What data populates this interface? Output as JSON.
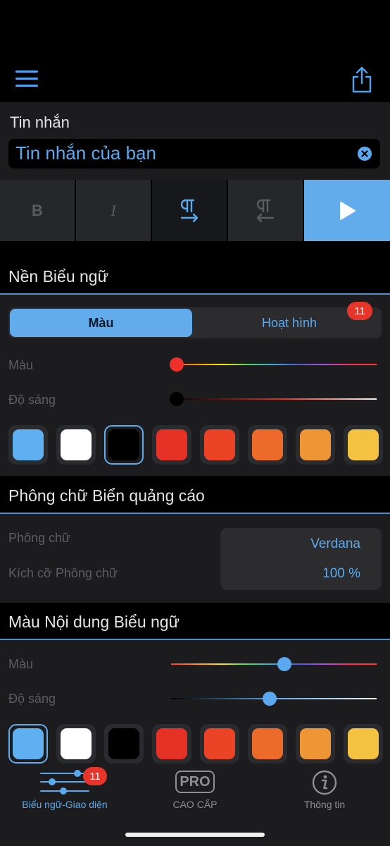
{
  "toolbar": {
    "menu_icon": "hamburger-menu-icon",
    "share_icon": "share-icon"
  },
  "message": {
    "label": "Tin nhắn",
    "value": "Tin nhắn của bạn"
  },
  "format_buttons": [
    {
      "label": "B",
      "name": "bold"
    },
    {
      "label": "I",
      "name": "italic"
    },
    {
      "name": "paragraph-ltr"
    },
    {
      "name": "paragraph-rtl"
    },
    {
      "name": "play"
    }
  ],
  "banner_background": {
    "title": "Nền Biểu ngữ",
    "tab_color": "Màu",
    "tab_animation": "Hoạt hình",
    "animation_badge": "11",
    "hue_label": "Màu",
    "brightness_label": "Độ sáng",
    "hue_value": 0.0,
    "brightness_value": 0.0,
    "swatches": [
      "#5eb0f0",
      "#ffffff",
      "#000000",
      "#e63226",
      "#ea4326",
      "#ec6a2a",
      "#ee9535",
      "#f3c240"
    ],
    "selected_swatch": 2
  },
  "banner_font": {
    "title": "Phông chữ Biển quảng cáo",
    "font_label": "Phông chữ",
    "font_value": "Verdana",
    "size_label": "Kích cỡ Phông chữ",
    "size_value": "100 %"
  },
  "banner_content_color": {
    "title": "Màu Nội dung Biểu ngữ",
    "hue_label": "Màu",
    "brightness_label": "Độ sáng",
    "hue_value": 0.55,
    "brightness_value": 0.48,
    "swatches": [
      "#5eb0f0",
      "#ffffff",
      "#000000",
      "#e63226",
      "#ea4326",
      "#ec6a2a",
      "#ee9535",
      "#f3c240"
    ],
    "selected_swatch": 0
  },
  "tabbar": {
    "tabs": [
      {
        "label": "Biểu ngữ-Giao diện",
        "badge": "11",
        "active": true
      },
      {
        "label": "CAO CẤP",
        "icon_text": "PRO",
        "active": false
      },
      {
        "label": "Thông tin",
        "active": false
      }
    ]
  },
  "colors": {
    "accent": "#5aa9ee",
    "badge": "#e6352b",
    "panel": "#1c1c1e"
  }
}
